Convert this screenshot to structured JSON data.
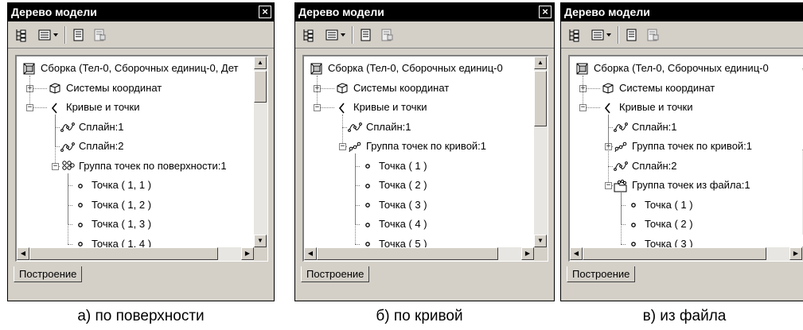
{
  "panels": [
    {
      "title": "Дерево модели",
      "tab_label": "Построение",
      "caption": "а) по поверхности",
      "rows": [
        {
          "text": "Сборка (Тел-0, Сборочных единиц-0, Дет",
          "icon": "assembly-icon",
          "depth": 0,
          "expander": ""
        },
        {
          "text": "Системы координат",
          "icon": "coordinate-systems-icon",
          "depth": 1,
          "expander": "+"
        },
        {
          "text": "Кривые и точки",
          "icon": "curves-points-icon",
          "depth": 1,
          "expander": "−"
        },
        {
          "text": "Сплайн:1",
          "icon": "spline-icon",
          "depth": 2,
          "expander": ""
        },
        {
          "text": "Сплайн:2",
          "icon": "spline-icon",
          "depth": 2,
          "expander": ""
        },
        {
          "text": "Группа точек по поверхности:1",
          "icon": "surface-point-group-icon",
          "depth": 2,
          "expander": "−"
        },
        {
          "text": "Точка ( 1, 1 )",
          "icon": "point-icon",
          "depth": 3,
          "expander": ""
        },
        {
          "text": "Точка ( 1, 2 )",
          "icon": "point-icon",
          "depth": 3,
          "expander": ""
        },
        {
          "text": "Точка ( 1, 3 )",
          "icon": "point-icon",
          "depth": 3,
          "expander": ""
        },
        {
          "text": "Точка ( 1, 4 )",
          "icon": "point-icon",
          "depth": 3,
          "expander": ""
        }
      ]
    },
    {
      "title": "Дерево модели",
      "tab_label": "Построение",
      "caption": "б) по кривой",
      "rows": [
        {
          "text": "Сборка (Тел-0, Сборочных единиц-0",
          "icon": "assembly-icon",
          "depth": 0,
          "expander": ""
        },
        {
          "text": "Системы координат",
          "icon": "coordinate-systems-icon",
          "depth": 1,
          "expander": "+"
        },
        {
          "text": "Кривые и точки",
          "icon": "curves-points-icon",
          "depth": 1,
          "expander": "−"
        },
        {
          "text": "Сплайн:1",
          "icon": "spline-icon",
          "depth": 2,
          "expander": ""
        },
        {
          "text": "Группа точек по кривой:1",
          "icon": "curve-point-group-icon",
          "depth": 2,
          "expander": "−"
        },
        {
          "text": "Точка ( 1 )",
          "icon": "point-icon",
          "depth": 3,
          "expander": ""
        },
        {
          "text": "Точка ( 2 )",
          "icon": "point-icon",
          "depth": 3,
          "expander": ""
        },
        {
          "text": "Точка ( 3 )",
          "icon": "point-icon",
          "depth": 3,
          "expander": ""
        },
        {
          "text": "Точка ( 4 )",
          "icon": "point-icon",
          "depth": 3,
          "expander": ""
        },
        {
          "text": "Точка ( 5 )",
          "icon": "point-icon",
          "depth": 3,
          "expander": ""
        }
      ]
    },
    {
      "title": "Дерево модели",
      "tab_label": "Построение",
      "caption": "в) из файла",
      "rows": [
        {
          "text": "Сборка (Тел-0, Сборочных единиц-0",
          "icon": "assembly-icon",
          "depth": 0,
          "expander": ""
        },
        {
          "text": "Системы координат",
          "icon": "coordinate-systems-icon",
          "depth": 1,
          "expander": "+"
        },
        {
          "text": "Кривые и точки",
          "icon": "curves-points-icon",
          "depth": 1,
          "expander": "−"
        },
        {
          "text": "Сплайн:1",
          "icon": "spline-icon",
          "depth": 2,
          "expander": ""
        },
        {
          "text": "Группа точек по кривой:1",
          "icon": "curve-point-group-icon",
          "depth": 2,
          "expander": "+"
        },
        {
          "text": "Сплайн:2",
          "icon": "spline-icon",
          "depth": 2,
          "expander": ""
        },
        {
          "text": "Группа точек из файла:1",
          "icon": "file-point-group-icon",
          "depth": 2,
          "expander": "−"
        },
        {
          "text": "Точка ( 1 )",
          "icon": "point-icon",
          "depth": 3,
          "expander": ""
        },
        {
          "text": "Точка ( 2 )",
          "icon": "point-icon",
          "depth": 3,
          "expander": ""
        },
        {
          "text": "Точка ( 3 )",
          "icon": "point-icon",
          "depth": 3,
          "expander": ""
        }
      ]
    }
  ],
  "colors": {
    "window_bg": "#d4d0c8",
    "titlebar_bg": "#000000",
    "tree_bg": "#ffffff",
    "tree_lines": "#808080"
  }
}
